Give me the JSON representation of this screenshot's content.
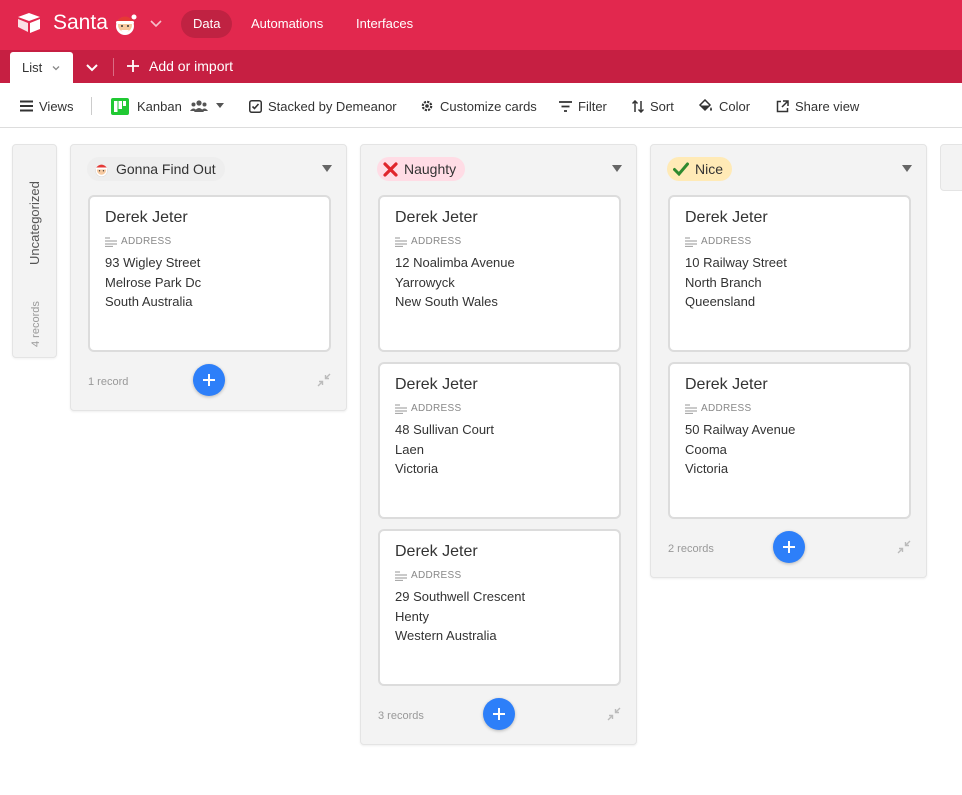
{
  "header": {
    "base_name": "Santa",
    "nav": [
      {
        "label": "Data",
        "active": true
      },
      {
        "label": "Automations",
        "active": false
      },
      {
        "label": "Interfaces",
        "active": false
      }
    ],
    "color": "#e2284e"
  },
  "tabbar": {
    "view_tab": "List",
    "add_import": "Add or import"
  },
  "toolbar": {
    "views": "Views",
    "view_type": "Kanban",
    "stacked_by": "Stacked by Demeanor",
    "customize": "Customize cards",
    "filter": "Filter",
    "sort": "Sort",
    "color": "Color",
    "share": "Share view"
  },
  "uncategorized": {
    "label": "Uncategorized",
    "count": "4 records"
  },
  "stacks": [
    {
      "name": "Gonna Find Out",
      "icon": "santa-emoji-icon",
      "chip_color": "#eeeeee",
      "cards": [
        {
          "title": "Derek Jeter",
          "field_label": "ADDRESS",
          "lines": [
            "93 Wigley Street",
            "Melrose Park Dc",
            "South Australia"
          ]
        }
      ],
      "count": "1 record"
    },
    {
      "name": "Naughty",
      "icon": "red-x-icon",
      "chip_color": "#ffdce5",
      "cards": [
        {
          "title": "Derek Jeter",
          "field_label": "ADDRESS",
          "lines": [
            "12 Noalimba Avenue",
            "Yarrowyck",
            "New South Wales"
          ]
        },
        {
          "title": "Derek Jeter",
          "field_label": "ADDRESS",
          "lines": [
            "48 Sullivan Court",
            "Laen",
            "Victoria"
          ]
        },
        {
          "title": "Derek Jeter",
          "field_label": "ADDRESS",
          "lines": [
            "29 Southwell Crescent",
            "Henty",
            "Western Australia"
          ]
        }
      ],
      "count": "3 records"
    },
    {
      "name": "Nice",
      "icon": "green-check-icon",
      "chip_color": "#ffeab6",
      "cards": [
        {
          "title": "Derek Jeter",
          "field_label": "ADDRESS",
          "lines": [
            "10 Railway Street",
            "North Branch",
            "Queensland"
          ]
        },
        {
          "title": "Derek Jeter",
          "field_label": "ADDRESS",
          "lines": [
            "50 Railway Avenue",
            "Cooma",
            "Victoria"
          ]
        }
      ],
      "count": "2 records"
    }
  ],
  "accent": "#2d7ff9"
}
